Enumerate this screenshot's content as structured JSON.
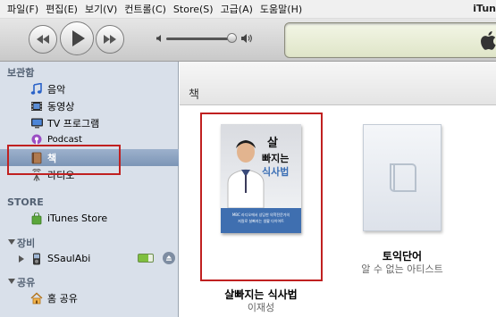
{
  "menubar": {
    "items": [
      "파일(F)",
      "편집(E)",
      "보기(V)",
      "컨트롤(C)",
      "Store(S)",
      "고급(A)",
      "도움말(H)"
    ],
    "app_title": "iTun"
  },
  "sidebar": {
    "library": {
      "header": "보관함",
      "items": [
        {
          "label": "음악",
          "icon": "music-note-icon"
        },
        {
          "label": "동영상",
          "icon": "film-icon"
        },
        {
          "label": "TV 프로그램",
          "icon": "tv-icon"
        },
        {
          "label": "Podcast",
          "icon": "podcast-icon"
        },
        {
          "label": "책",
          "icon": "book-icon",
          "selected": true
        },
        {
          "label": "라디오",
          "icon": "radio-antenna-icon"
        }
      ]
    },
    "store": {
      "header": "STORE",
      "items": [
        {
          "label": "iTunes Store",
          "icon": "store-bag-icon"
        }
      ]
    },
    "devices": {
      "header": "장비",
      "items": [
        {
          "label": "SSaulAbi",
          "icon": "ipod-icon"
        }
      ]
    },
    "shared": {
      "header": "공유",
      "items": [
        {
          "label": "홈 공유",
          "icon": "home-icon"
        }
      ]
    }
  },
  "main": {
    "section_title": "책",
    "books": [
      {
        "title": "살빠지는 식사법",
        "artist": "이재성",
        "highlighted": true
      },
      {
        "title": "토익단어",
        "artist": "알 수 없는 아티스트"
      }
    ],
    "cover_text": {
      "top_line": "살",
      "main_line1": "빠지는",
      "main_line2": "식사법",
      "blurb1": "MBC 라디오에서 상담한 의학전문가의",
      "blurb2": "저칼로 살빠지는 생활 다이어트"
    }
  },
  "colors": {
    "sidebar_bg": "#d9e0ea",
    "selection": "#8ea4c2",
    "highlight": "#c02020"
  }
}
